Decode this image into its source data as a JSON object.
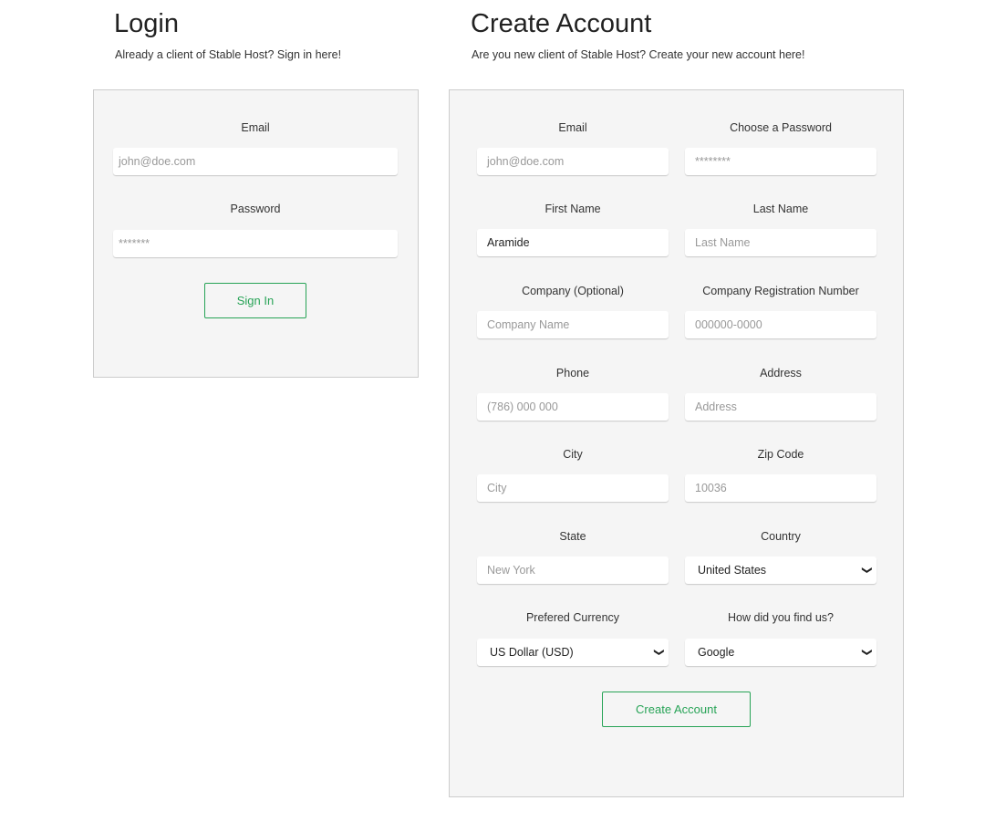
{
  "login": {
    "title": "Login",
    "subtitle": "Already a client of Stable Host? Sign in here!",
    "email_label": "Email",
    "email_placeholder": "john@doe.com",
    "password_label": "Password",
    "password_placeholder": "*******",
    "sign_in_label": "Sign In"
  },
  "create": {
    "title": "Create Account",
    "subtitle": "Are you new client of Stable Host? Create your new account here!",
    "fields": [
      {
        "name": "email",
        "label": "Email",
        "placeholder": "john@doe.com",
        "value": ""
      },
      {
        "name": "password",
        "label": "Choose a Password",
        "placeholder": "********",
        "value": ""
      },
      {
        "name": "first-name",
        "label": "First Name",
        "placeholder": "",
        "value": "Aramide"
      },
      {
        "name": "last-name",
        "label": "Last Name",
        "placeholder": "Last Name",
        "value": ""
      },
      {
        "name": "company",
        "label": "Company (Optional)",
        "placeholder": "Company Name",
        "value": ""
      },
      {
        "name": "company-registration",
        "label": "Company Registration Number",
        "placeholder": "000000-0000",
        "value": ""
      },
      {
        "name": "phone",
        "label": "Phone",
        "placeholder": "(786) 000 000",
        "value": ""
      },
      {
        "name": "address",
        "label": "Address",
        "placeholder": "Address",
        "value": ""
      },
      {
        "name": "city",
        "label": "City",
        "placeholder": "City",
        "value": ""
      },
      {
        "name": "zip-code",
        "label": "Zip Code",
        "placeholder": "10036",
        "value": ""
      },
      {
        "name": "state",
        "label": "State",
        "placeholder": "New York",
        "value": ""
      },
      {
        "name": "country",
        "label": "Country",
        "select": "United States"
      },
      {
        "name": "currency",
        "label": "Prefered Currency",
        "select": "US Dollar (USD)"
      },
      {
        "name": "referral",
        "label": "How did you find us?",
        "select": "Google"
      }
    ],
    "submit_label": "Create Account"
  },
  "colors": {
    "accent": "#27a356",
    "panel": "#f5f5f5"
  }
}
